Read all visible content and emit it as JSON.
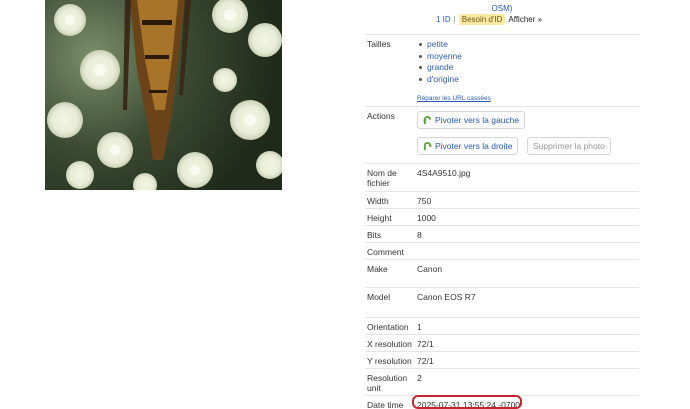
{
  "header": {
    "osm_text": "OSM)",
    "id_count": "1 ID",
    "separator": "|",
    "needs_id_badge": "Besoin d'ID",
    "show_link": "Afficher »"
  },
  "sizes": {
    "label": "Tailles",
    "items": [
      "petite",
      "moyenne",
      "grande",
      "d'origine"
    ],
    "repair_link": "Réparer les URL cassées"
  },
  "actions": {
    "label": "Actions",
    "rotate_left": "Pivoter vers la gauche",
    "rotate_right": "Pivoter vers la droite",
    "delete_photo": "Supprimer la photo"
  },
  "metadata": {
    "filename_label": "Nom de fichier",
    "filename": "4S4A9510.jpg",
    "width_label": "Width",
    "width": "750",
    "height_label": "Height",
    "height": "1000",
    "bits_label": "Bits",
    "bits": "8",
    "comment_label": "Comment",
    "comment": "",
    "make_label": "Make",
    "make": "Canon",
    "model_label": "Model",
    "model": "Canon EOS R7",
    "orientation_label": "Orientation",
    "orientation": "1",
    "xres_label": "X resolution",
    "xres": "72/1",
    "yres_label": "Y resolution",
    "yres": "72/1",
    "resunit_label": "Resolution unit",
    "resunit": "2",
    "datetime_label": "Date time",
    "datetime": "2025-07-31 13:55:24 -0700"
  },
  "colors": {
    "link": "#2a5db0",
    "badge_bg": "#fbe9a3",
    "highlight": "#c3262f"
  },
  "icons": {
    "rotate_left": "rotate-left-icon",
    "rotate_right": "rotate-right-icon"
  }
}
